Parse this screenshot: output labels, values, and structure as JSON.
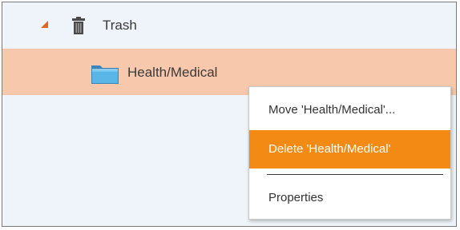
{
  "tree": {
    "trash": {
      "label": "Trash",
      "icon": "trash-icon",
      "expander_icon": "expanded-arrow-icon",
      "expanded": true
    },
    "health": {
      "label": "Health/Medical",
      "icon": "folder-icon",
      "selected": true
    }
  },
  "context_menu": {
    "items": [
      {
        "label": "Move 'Health/Medical'...",
        "highlighted": false
      },
      {
        "label": "Delete 'Health/Medical'",
        "highlighted": true
      },
      {
        "label": "Properties",
        "highlighted": false
      }
    ]
  },
  "colors": {
    "background": "#eef4f9",
    "selection": "#f7c8ab",
    "menu_highlight": "#f28a13",
    "expander": "#e2651d",
    "text": "#3a3a3a"
  }
}
